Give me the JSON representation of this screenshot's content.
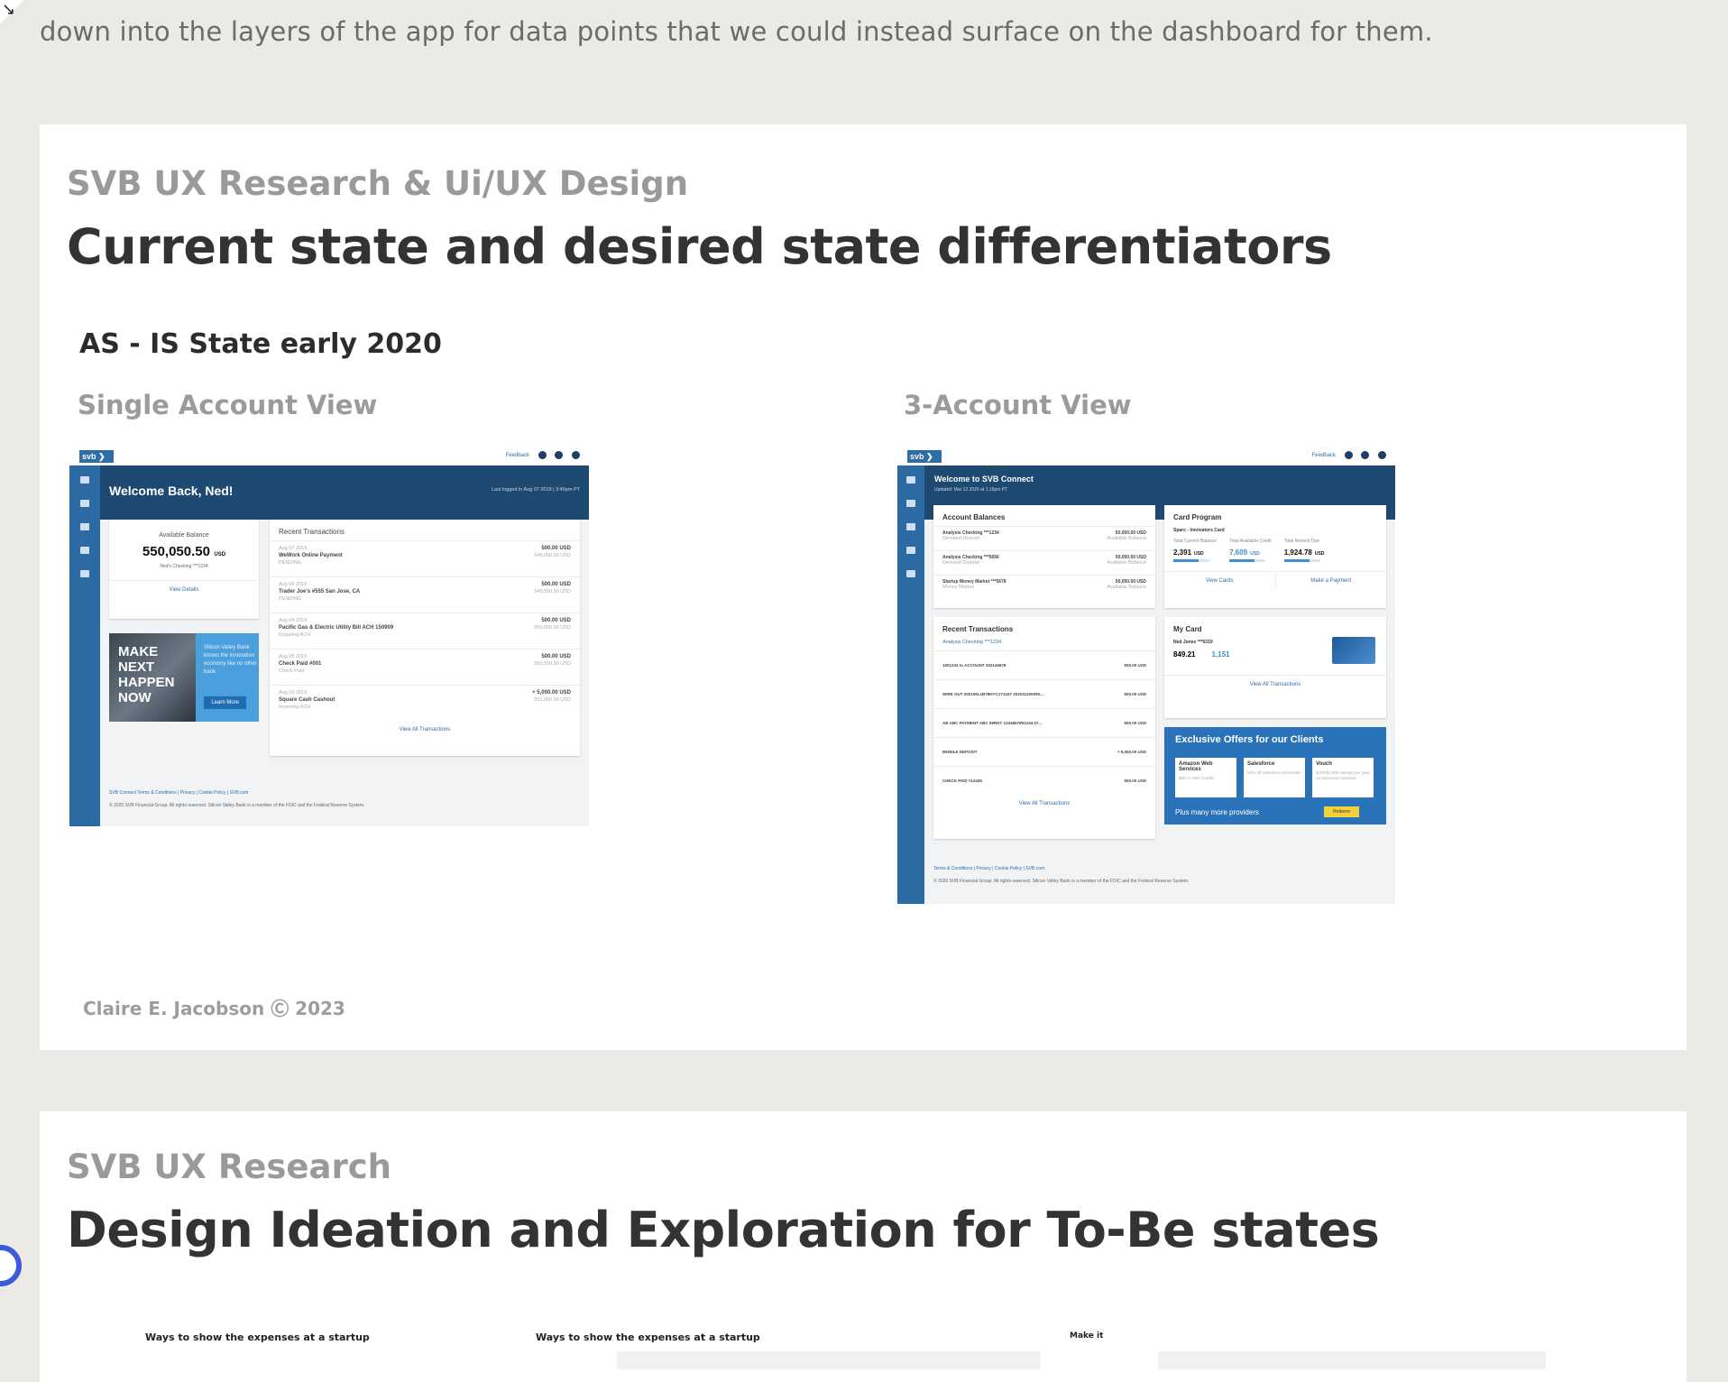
{
  "intro_text": "down into the layers of the app for data points that we could instead surface on the dashboard for them.",
  "card1": {
    "eyebrow": "SVB UX Research & Ui/UX Design",
    "title": "Current state and desired state differentiators",
    "state_label": "AS - IS State early 2020",
    "left_view_label": "Single Account View",
    "right_view_label": "3-Account View",
    "footer_note": "Claire E. Jacobson Ⓒ 2023",
    "single_view": {
      "logo": "svb ❯",
      "topbar_link": "Feedback",
      "welcome": "Welcome Back, Ned!",
      "last_login": "Last logged in Aug 07 2019  |  3:45pm PT",
      "balance_label": "Available Balance",
      "balance_value": "550,050.50",
      "balance_currency": "USD",
      "account_name": "Ned's Checking ***1234",
      "view_details": "View Details",
      "promo_big": "MAKE\nNEXT\nHAPPEN\nNOW",
      "promo_small": "Silicon Valley Bank knows the innovation economy like no other bank.",
      "promo_button": "Learn More",
      "transactions_title": "Recent Transactions",
      "transactions": [
        {
          "date": "Aug 07 2019",
          "name": "WeWork Online Payment",
          "status": "PENDING",
          "amount": "500.00 USD",
          "balance": "549,050.50 USD"
        },
        {
          "date": "Aug 06 2019",
          "name": "Trader Joe's #555 San Jose, CA",
          "status": "PENDING",
          "amount": "500.00 USD",
          "balance": "549,550.50 USD"
        },
        {
          "date": "Aug 04 2019",
          "name": "Pacific Gas & Electric Utility Bill ACH 150909",
          "status": "Outgoing ACH",
          "amount": "500.00 USD",
          "balance": "550,050.50 USD"
        },
        {
          "date": "Aug 05 2019",
          "name": "Check Paid #001",
          "status": "Check Paid",
          "amount": "500.00 USD",
          "balance": "550,550.50 USD"
        },
        {
          "date": "Aug 03 2019",
          "name": "Square Cash Cashout",
          "status": "Incoming ACH",
          "amount": "+ 5,000.00 USD",
          "balance": "551,050.50 USD"
        }
      ],
      "view_all": "View All Transactions",
      "footer_links": "SVB Connect Terms & Conditions  |  Privacy  |  Cookie Policy  |  SVB.com",
      "copyright": "© 2020 SVB Financial Group. All rights reserved. Silicon Valley Bank is a member of the FDIC and the Federal Reserve System."
    },
    "three_view": {
      "logo": "svb ❯",
      "topbar_link": "Feedback",
      "welcome": "Welcome to SVB Connect",
      "updated": "Updated: Mar 12 2020 at 1:15pm PT",
      "balances_title": "Account Balances",
      "accounts": [
        {
          "name": "Analysis Checking ***1234",
          "type": "Demand Deposit",
          "amount": "50,050.50 USD",
          "label": "Available Balance"
        },
        {
          "name": "Analysis Checking ***5656",
          "type": "Demand Deposit",
          "amount": "50,050.50 USD",
          "label": "Available Balance"
        },
        {
          "name": "Startup Money Market ***5678",
          "type": "Money Market",
          "amount": "50,050.50 USD",
          "label": "Available Balance"
        }
      ],
      "card_program_title": "Card Program",
      "card_program_name": "Sparc - Innovators Card",
      "card_stats": [
        {
          "label": "Total Current Balance",
          "value": "2,391",
          "unit": "USD"
        },
        {
          "label": "Total Available Credit",
          "value": "7,609",
          "unit": "USD"
        },
        {
          "label": "Total Amount Due",
          "value": "1,924.78",
          "unit": "USD"
        }
      ],
      "view_cards": "View Cards",
      "make_payment": "Make a Payment",
      "recent_title": "Recent Transactions",
      "recent_filter": "Analysis Checking ***1234",
      "recent_rows": [
        {
          "name": "1001234 to ACCOUNT 202145678",
          "amount": "500.00 USD"
        },
        {
          "name": "WIRE OUT 200106L1B78HYC1Y1167 202031100090...",
          "amount": "500.00 USD"
        },
        {
          "name": "AB ABC PAYMENT ABC 09RNY 1234567891234 07...",
          "amount": "500.00 USD"
        },
        {
          "name": "MOBILE DEPOSIT",
          "amount": "+ 5,000.00 USD"
        },
        {
          "name": "CHECK PAID #12345",
          "amount": "500.00 USD"
        }
      ],
      "view_all": "View All Transactions",
      "my_card_title": "My Card",
      "my_card_name": "Ned Jones ***6319",
      "my_card_balance": "849.21",
      "my_card_spend": "1,151",
      "my_card_currency": "USD",
      "my_card_link": "View All Transactions",
      "offers_title": "Exclusive Offers for our Clients",
      "offers": [
        {
          "name": "Amazon Web Services",
          "desc": "$5K in AWS Credits"
        },
        {
          "name": "Salesforce",
          "desc": "50% off Salesforce Essentials"
        },
        {
          "name": "Vouch",
          "desc": "$100-$2,500 savings per year on business insurance"
        }
      ],
      "offers_more": "Plus many more providers",
      "redeem": "Redeem",
      "footer_links": "Terms & Conditions  |  Privacy  |  Cookie Policy  |  SVB.com",
      "copyright": "© 2020 SVB Financial Group. All rights reserved. Silicon Valley Bank is a member of the FDIC and the Federal Reserve System."
    }
  },
  "card2": {
    "eyebrow": "SVB UX Research",
    "title": "Design Ideation and Exploration for To-Be states",
    "sketch_label_1": "Ways to show the expenses at a startup",
    "sketch_label_2": "Ways to show the expenses at a startup",
    "sketch_label_3": "Make it"
  }
}
